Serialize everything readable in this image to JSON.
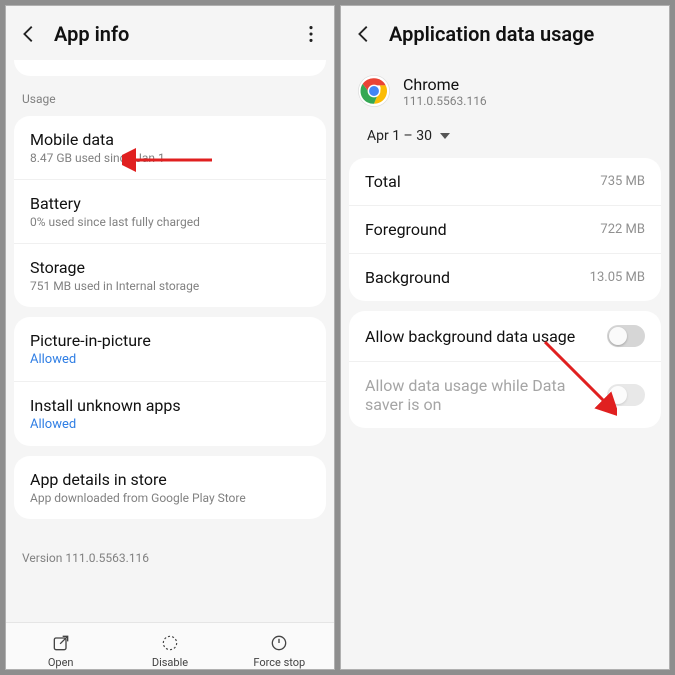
{
  "left": {
    "header_title": "App info",
    "section_usage": "Usage",
    "mobile_data": {
      "title": "Mobile data",
      "sub": "8.47 GB used since Jan 1"
    },
    "battery": {
      "title": "Battery",
      "sub": "0% used since last fully charged"
    },
    "storage": {
      "title": "Storage",
      "sub": "751 MB used in Internal storage"
    },
    "pip": {
      "title": "Picture-in-picture",
      "value": "Allowed"
    },
    "unknown": {
      "title": "Install unknown apps",
      "value": "Allowed"
    },
    "store": {
      "title": "App details in store",
      "sub": "App downloaded from Google Play Store"
    },
    "version_label": "Version 111.0.5563.116",
    "bottom": {
      "open": "Open",
      "disable": "Disable",
      "force_stop": "Force stop"
    }
  },
  "right": {
    "header_title": "Application data usage",
    "app_name": "Chrome",
    "app_version": "111.0.5563.116",
    "date_range": "Apr 1 – 30",
    "stats": {
      "total": {
        "label": "Total",
        "value": "735 MB"
      },
      "foreground": {
        "label": "Foreground",
        "value": "722 MB"
      },
      "background": {
        "label": "Background",
        "value": "13.05 MB"
      }
    },
    "allow_bg": "Allow background data usage",
    "allow_ds": "Allow data usage while Data saver is on"
  }
}
